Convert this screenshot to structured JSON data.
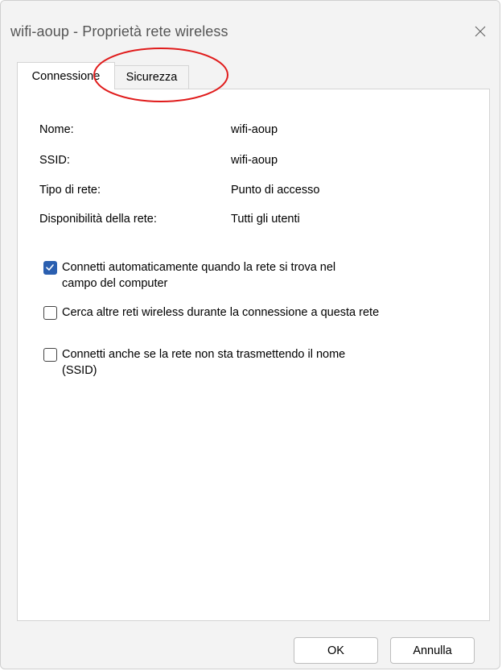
{
  "window": {
    "title": "wifi-aoup - Proprietà rete wireless",
    "close_icon": "close-icon"
  },
  "tabs": [
    {
      "label": "Connessione",
      "active": true
    },
    {
      "label": "Sicurezza",
      "active": false
    }
  ],
  "properties": [
    {
      "label": "Nome:",
      "value": "wifi-aoup"
    },
    {
      "label": "SSID:",
      "value": "wifi-aoup"
    },
    {
      "label": "Tipo di rete:",
      "value": "Punto di accesso"
    },
    {
      "label": "Disponibilità della rete:",
      "value": "Tutti gli utenti"
    }
  ],
  "options": [
    {
      "line1": "Connetti automaticamente quando la rete si trova nel",
      "line2": "campo del computer",
      "checked": true
    },
    {
      "line1": "Cerca altre reti wireless durante la connessione a questa rete",
      "line2": "",
      "checked": false
    },
    {
      "line1": "Connetti anche se la rete non sta trasmettendo il nome",
      "line2": "(SSID)",
      "checked": false
    }
  ],
  "buttons": {
    "ok": "OK",
    "cancel": "Annulla"
  },
  "colors": {
    "accent": "#2a5fb0",
    "annotation": "#e01b1b"
  }
}
